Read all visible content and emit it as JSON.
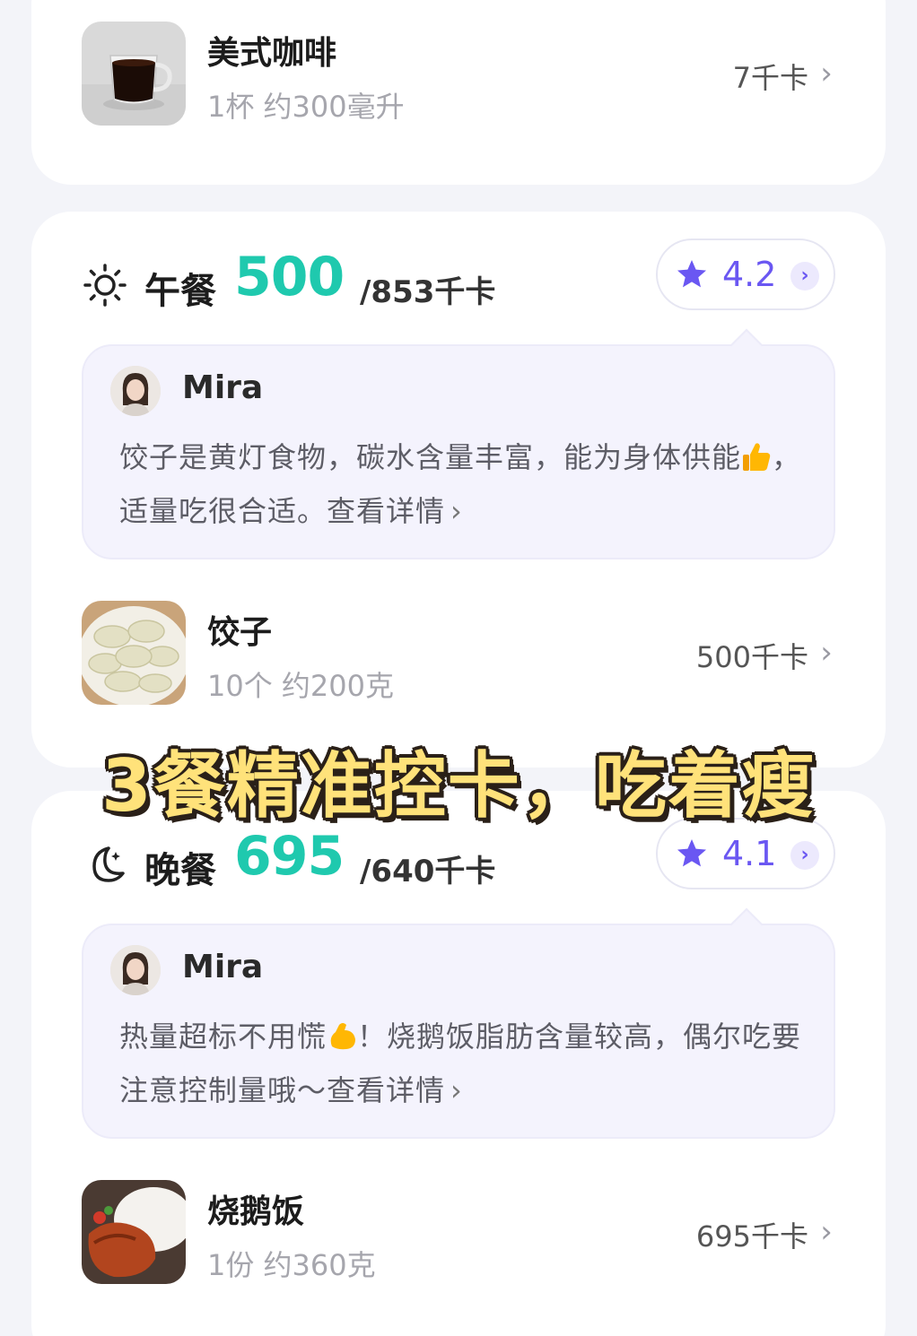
{
  "breakfast": {
    "food": {
      "name": "美式咖啡",
      "portion": "1杯 约300毫升",
      "kcal": "7千卡",
      "image": "coffee-cup-image"
    }
  },
  "lunch": {
    "title": "午餐",
    "kcal_eaten": "500",
    "kcal_target": "/853千卡",
    "rating": "4.2",
    "icon": "sun-icon",
    "comment": {
      "author": "Mira",
      "text_before_emoji": "饺子是黄灯食物，碳水含量丰富，能为身体供能",
      "emoji": "thumbs-up",
      "text_after_emoji": "，适量吃很合适。查看详情"
    },
    "food": {
      "name": "饺子",
      "portion": "10个 约200克",
      "kcal": "500千卡",
      "image": "dumplings-image"
    }
  },
  "promo_text": "3餐精准控卡，吃着瘦",
  "dinner": {
    "title": "晚餐",
    "kcal_eaten": "695",
    "kcal_target": "/640千卡",
    "rating": "4.1",
    "icon": "moon-icon",
    "comment": {
      "author": "Mira",
      "text_before_emoji": "热量超标不用慌",
      "emoji": "flexed-biceps",
      "text_after_emoji": "！烧鹅饭脂肪含量较高，偶尔吃要注意控制量哦～查看详情"
    },
    "food": {
      "name": "烧鹅饭",
      "portion": "1份 约360克",
      "kcal": "695千卡",
      "image": "roast-goose-rice-image"
    }
  },
  "colors": {
    "accent_kcal": "#1fc9ae",
    "rating_purple": "#6a57f2",
    "promo_yellow": "#ffe27a"
  }
}
